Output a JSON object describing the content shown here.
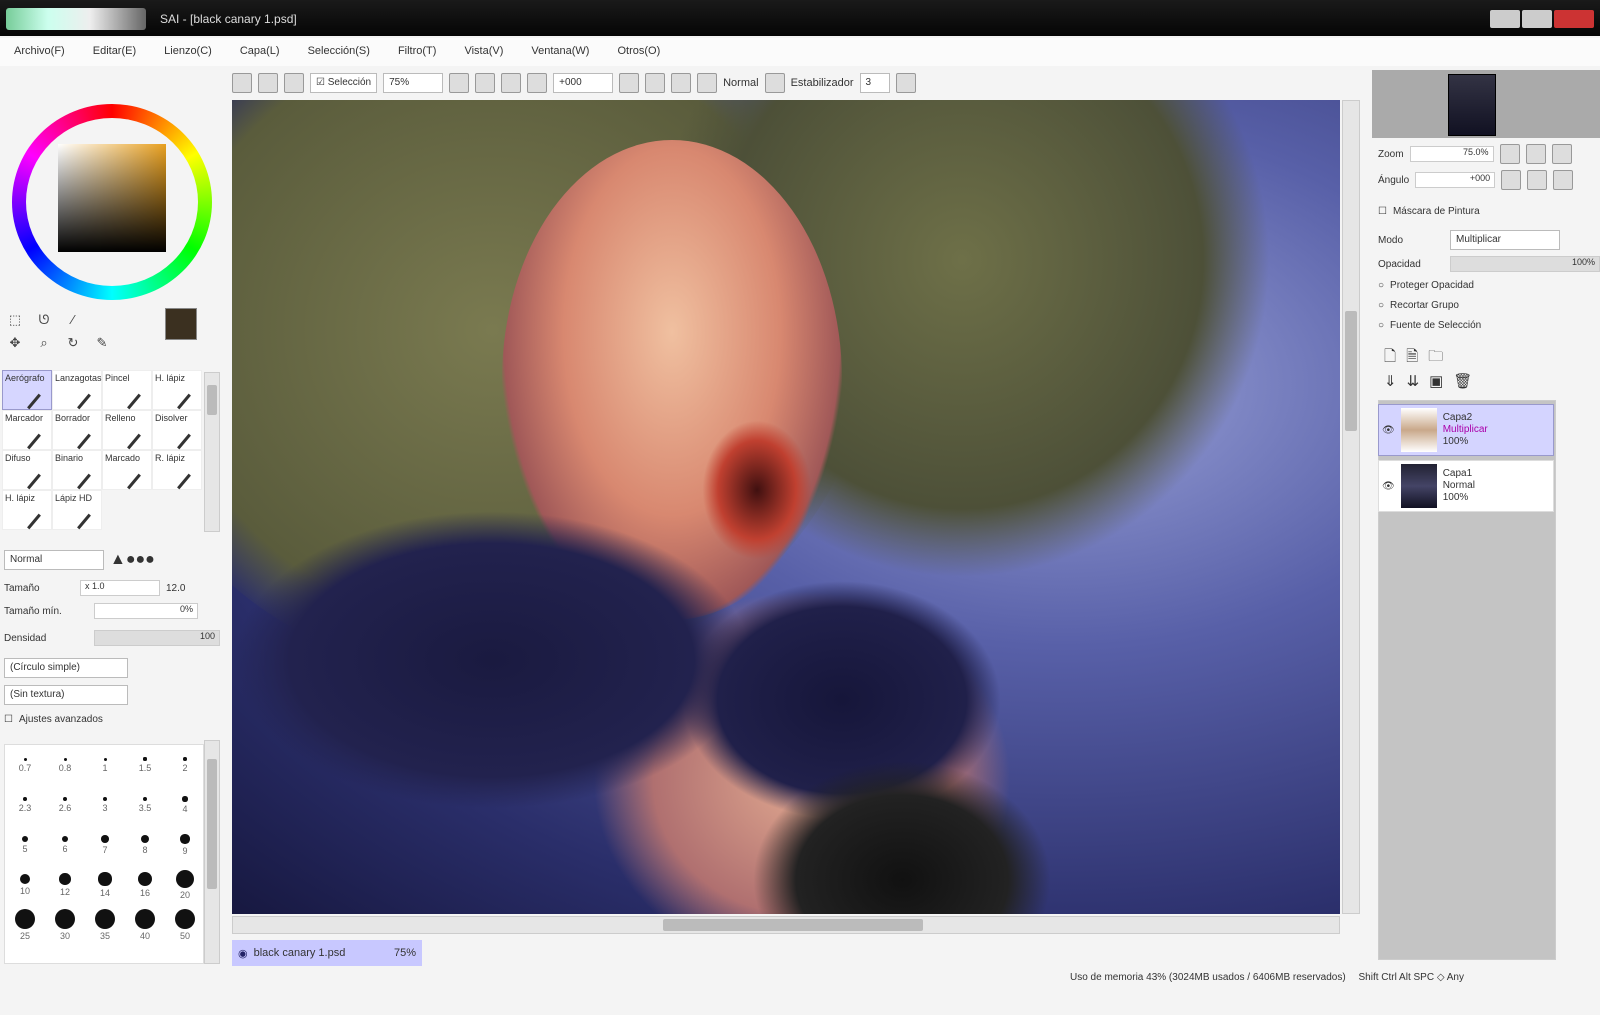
{
  "window": {
    "title": "SAI - [black canary 1.psd]"
  },
  "menu": [
    "Archivo(F)",
    "Editar(E)",
    "Lienzo(C)",
    "Capa(L)",
    "Selección(S)",
    "Filtro(T)",
    "Vista(V)",
    "Ventana(W)",
    "Otros(O)"
  ],
  "toolbar": {
    "selection_label": "Selección",
    "zoom": "75%",
    "angle": "+000",
    "mode_label": "Normal",
    "stabilizer_label": "Estabilizador",
    "stabilizer_value": "3"
  },
  "brush_tools": [
    {
      "label": "Aerógrafo",
      "selected": true
    },
    {
      "label": "Lanzagotas"
    },
    {
      "label": "Pincel"
    },
    {
      "label": "H. lápiz"
    },
    {
      "label": "Marcador"
    },
    {
      "label": "Borrador"
    },
    {
      "label": "Relleno"
    },
    {
      "label": "Disolver"
    },
    {
      "label": "Difuso"
    },
    {
      "label": "Binario"
    },
    {
      "label": "Marcado"
    },
    {
      "label": "R. lápiz"
    },
    {
      "label": "H. lápiz"
    },
    {
      "label": "Lápiz HD"
    }
  ],
  "brush_settings": {
    "mode": "Normal",
    "size_label": "Tamaño",
    "size_value": "x 1.0",
    "size_max": "12.0",
    "min_size_label": "Tamaño mín.",
    "min_size_value": "0%",
    "density_label": "Densidad",
    "density_value": "100",
    "shape": "(Círculo simple)",
    "texture": "(Sin textura)",
    "advanced_label": "Ajustes avanzados"
  },
  "brush_sizes": [
    "0.7",
    "0.8",
    "1",
    "1.5",
    "2",
    "2.3",
    "2.6",
    "3",
    "3.5",
    "4",
    "5",
    "6",
    "7",
    "8",
    "9",
    "10",
    "12",
    "14",
    "16",
    "20",
    "25",
    "30",
    "35",
    "40",
    "50"
  ],
  "document_tab": {
    "name": "black canary 1.psd",
    "zoom": "75%"
  },
  "navigator": {
    "zoom_label": "Zoom",
    "zoom_value": "75.0%",
    "angle_label": "Ángulo",
    "angle_value": "+000"
  },
  "layers_panel": {
    "preserve_opacity_toggle": "Máscara de Pintura",
    "mode_label": "Modo",
    "mode_value": "Multiplicar",
    "opacity_label": "Opacidad",
    "opacity_value": "100%",
    "options": [
      "Proteger Opacidad",
      "Recortar Grupo",
      "Fuente de Selección"
    ],
    "layers": [
      {
        "name": "Capa2",
        "mode": "Multiplicar",
        "opacity": "100%",
        "selected": true
      },
      {
        "name": "Capa1",
        "mode": "Normal",
        "opacity": "100%"
      }
    ]
  },
  "status": {
    "text": "Uso de memoria 43% (3024MB usados / 6406MB reservados)",
    "keys": "Shift Ctrl Alt SPC ◇ Any"
  }
}
